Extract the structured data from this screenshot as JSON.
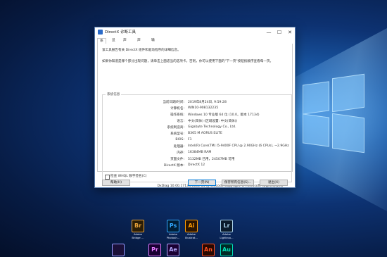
{
  "window": {
    "title": "DirectX 诊断工具",
    "minimize": "—",
    "maximize": "☐",
    "close": "✕"
  },
  "tabs": [
    {
      "label": "系统"
    },
    {
      "label": "显示"
    },
    {
      "label": "声音 1"
    },
    {
      "label": "声音 2"
    },
    {
      "label": "输入"
    }
  ],
  "intro": {
    "line1": "该工具报告有关 DirectX 组件和驱动程序的详细信息。",
    "line2": "如果你知道是哪个部分出现问题，请单击上面适当的选项卡。否则，你可以使用下面的\"下一页\"按钮按顺序查看每一页。"
  },
  "system_info": {
    "title": "系统信息",
    "rows": [
      {
        "label": "当前日期/时间:",
        "value": "2019年8月24日, 9:59:28"
      },
      {
        "label": "计算机名:",
        "value": "WIN10-908132235"
      },
      {
        "label": "操作系统:",
        "value": "Windows 10 专业版 64 位 (10.0，版本 17134)"
      },
      {
        "label": "语言:",
        "value": "中文(简体) (区域设置: 中文(简体))"
      },
      {
        "label": "系统制造商:",
        "value": "Gigabyte Technology Co., Ltd."
      },
      {
        "label": "系统型号:",
        "value": "B365 M AORUS ELITE"
      },
      {
        "label": "BIOS:",
        "value": "F1"
      },
      {
        "label": "处理器:",
        "value": "Intel(R) Core(TM) i5-9400F CPU @ 2.90GHz (6 CPUs), ~2.9GHz"
      },
      {
        "label": "内存:",
        "value": "16384MB RAM"
      },
      {
        "label": "页面文件:",
        "value": "5132MB 已用，24507MB 可用"
      },
      {
        "label": "DirectX 版本:",
        "value": "DirectX 12"
      }
    ]
  },
  "checkbox": {
    "label": "检查 WHQL 数字签名(C)"
  },
  "copyright": "DxDiag 10.00.17134.0001 64 位 Unicode  Copyright © Microsoft. 保留所有权利。",
  "buttons": {
    "help": "帮助(H)",
    "next": "下一页(N)",
    "save": "保存所有信息(S)...",
    "exit": "退出(X)"
  },
  "desktop_icons": [
    {
      "abbr": "Br",
      "line1": "Adobe",
      "line2": "Bridge ...",
      "color": "#2b1d06",
      "fg": "#e8a23a"
    },
    {
      "abbr": "Ps",
      "line1": "Adobe",
      "line2": "Photosh...",
      "color": "#001e36",
      "fg": "#31a8ff"
    },
    {
      "abbr": "Ai",
      "line1": "Adobe",
      "line2": "Illustrat...",
      "color": "#2b1400",
      "fg": "#ff9a00"
    },
    {
      "abbr": "Lr",
      "line1": "Adobe",
      "line2": "Lightroo...",
      "color": "#0a1a2a",
      "fg": "#add5ec"
    },
    {
      "abbr": "",
      "line1": "",
      "line2": "",
      "color": "#1b1038",
      "fg": "#9999ff"
    },
    {
      "abbr": "Pr",
      "line1": "",
      "line2": "",
      "color": "#1a0033",
      "fg": "#e579ff"
    },
    {
      "abbr": "Ae",
      "line1": "",
      "line2": "",
      "color": "#1a0033",
      "fg": "#b4a8ff"
    },
    {
      "abbr": "An",
      "line1": "",
      "line2": "",
      "color": "#2a0800",
      "fg": "#ff4f1f"
    },
    {
      "abbr": "Au",
      "line1": "",
      "line2": "",
      "color": "#002a26",
      "fg": "#00e4bb"
    }
  ]
}
